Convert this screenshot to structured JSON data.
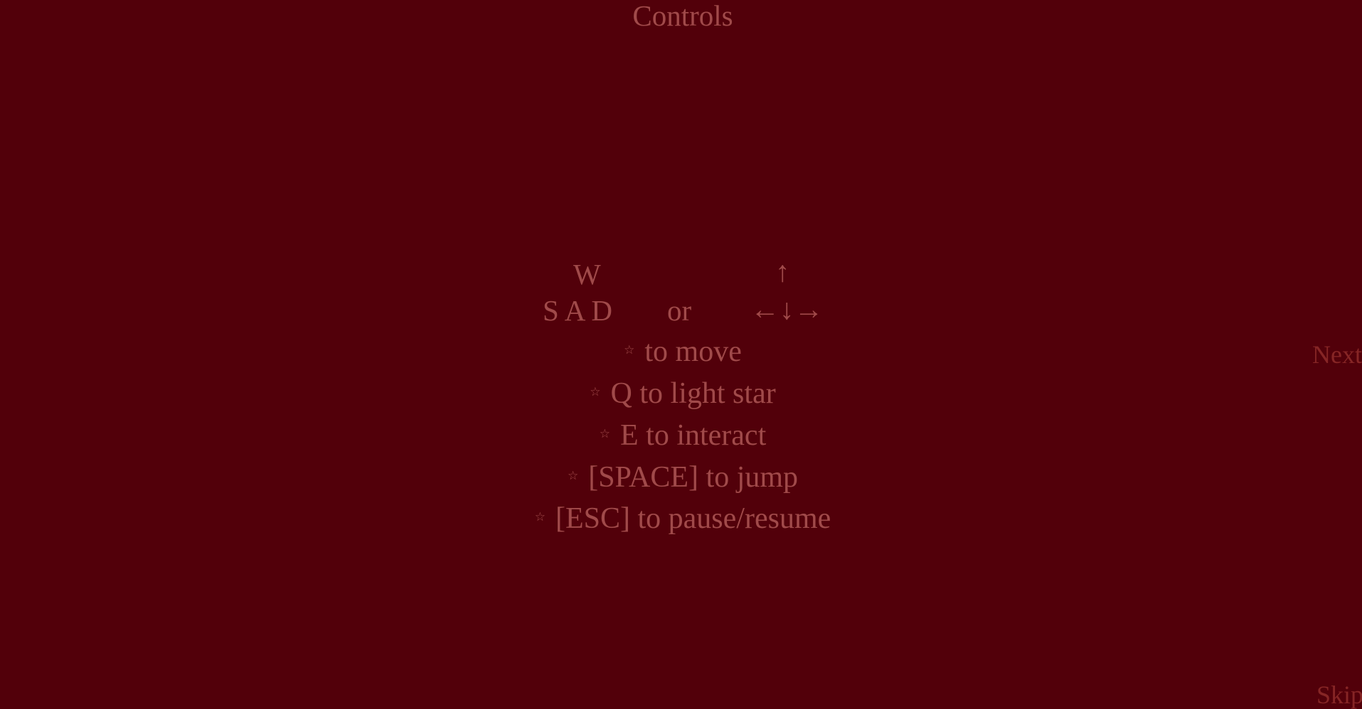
{
  "title": "Controls",
  "movement": {
    "wasd_top": "W",
    "wasd_bottom": "S A D",
    "or": "or",
    "arrow_up": "↑",
    "arrows_bottom": "←↓→"
  },
  "bullet_icon": "☆",
  "lines": [
    {
      "text": "to move"
    },
    {
      "text": "Q to light star"
    },
    {
      "text": "E to interact"
    },
    {
      "text": "[SPACE] to jump"
    },
    {
      "text": "[ESC] to pause/resume"
    }
  ],
  "next_label": "Next",
  "skip_label": "Skip",
  "colors": {
    "background": "#52000a",
    "text": "#a04a4a",
    "nav": "#862525"
  }
}
